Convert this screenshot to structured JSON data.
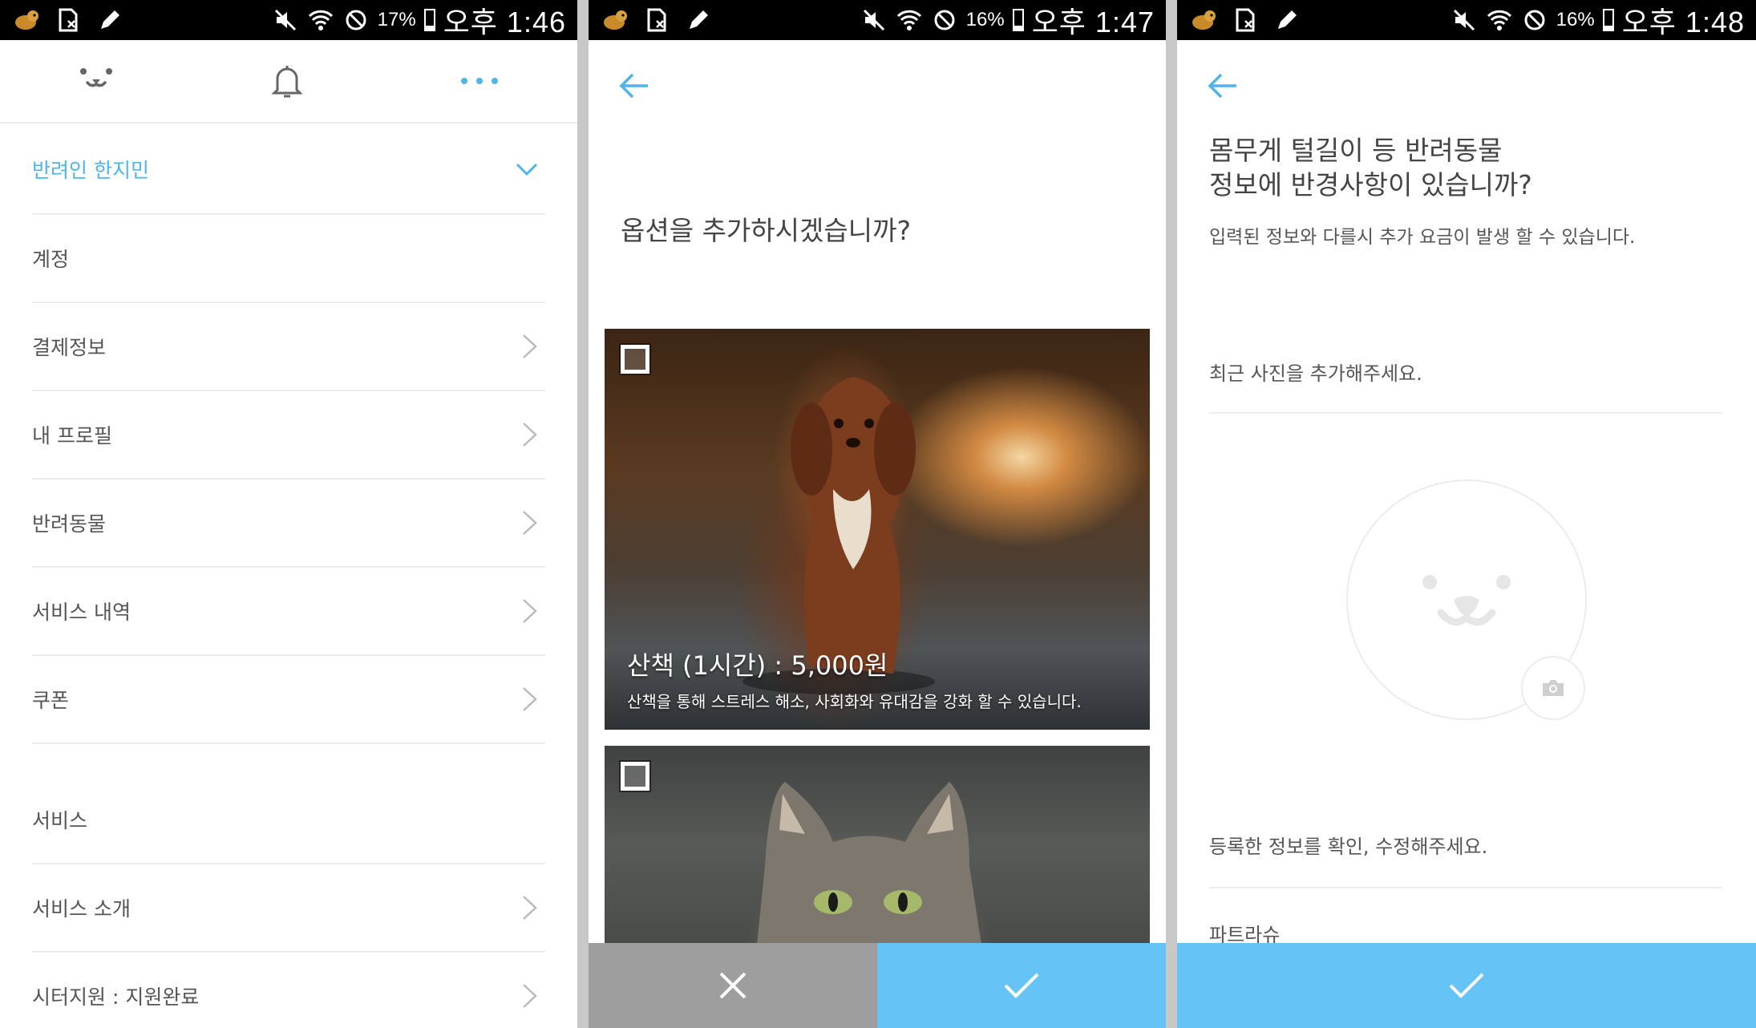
{
  "colors": {
    "accent": "#4fb4ea",
    "confirm": "#66c3f6",
    "cancel": "#9e9e9e"
  },
  "screens": [
    {
      "status": {
        "battery": "17%",
        "time": "오후 1:46"
      },
      "menu": {
        "user": "반려인 한지민",
        "items": [
          "계정",
          "결제정보",
          "내 프로필",
          "반려동물",
          "서비스 내역",
          "쿠폰"
        ],
        "section": "서비스",
        "section_items": [
          "서비스 소개",
          "시터지원 : 지원완료"
        ]
      }
    },
    {
      "status": {
        "battery": "16%",
        "time": "오후 1:47"
      },
      "title": "옵션을 추가하시겠습니까?",
      "options": [
        {
          "title": "산책 (1시간) : 5,000원",
          "desc": "산책을 통해 스트레스 해소, 사회화와 유대감을 강화 할 수 있습니다."
        }
      ]
    },
    {
      "status": {
        "battery": "16%",
        "time": "오후 1:48"
      },
      "title_line1": "몸무게 털길이 등 반려동물",
      "title_line2": "정보에 반경사항이 있습니까?",
      "subtitle": "입력된 정보와 다를시 추가 요금이 발생 할 수 있습니다.",
      "photo_label": "최근 사진을 추가해주세요.",
      "info_label": "등록한 정보를 확인, 수정해주세요.",
      "breed": "파트라슈"
    }
  ]
}
